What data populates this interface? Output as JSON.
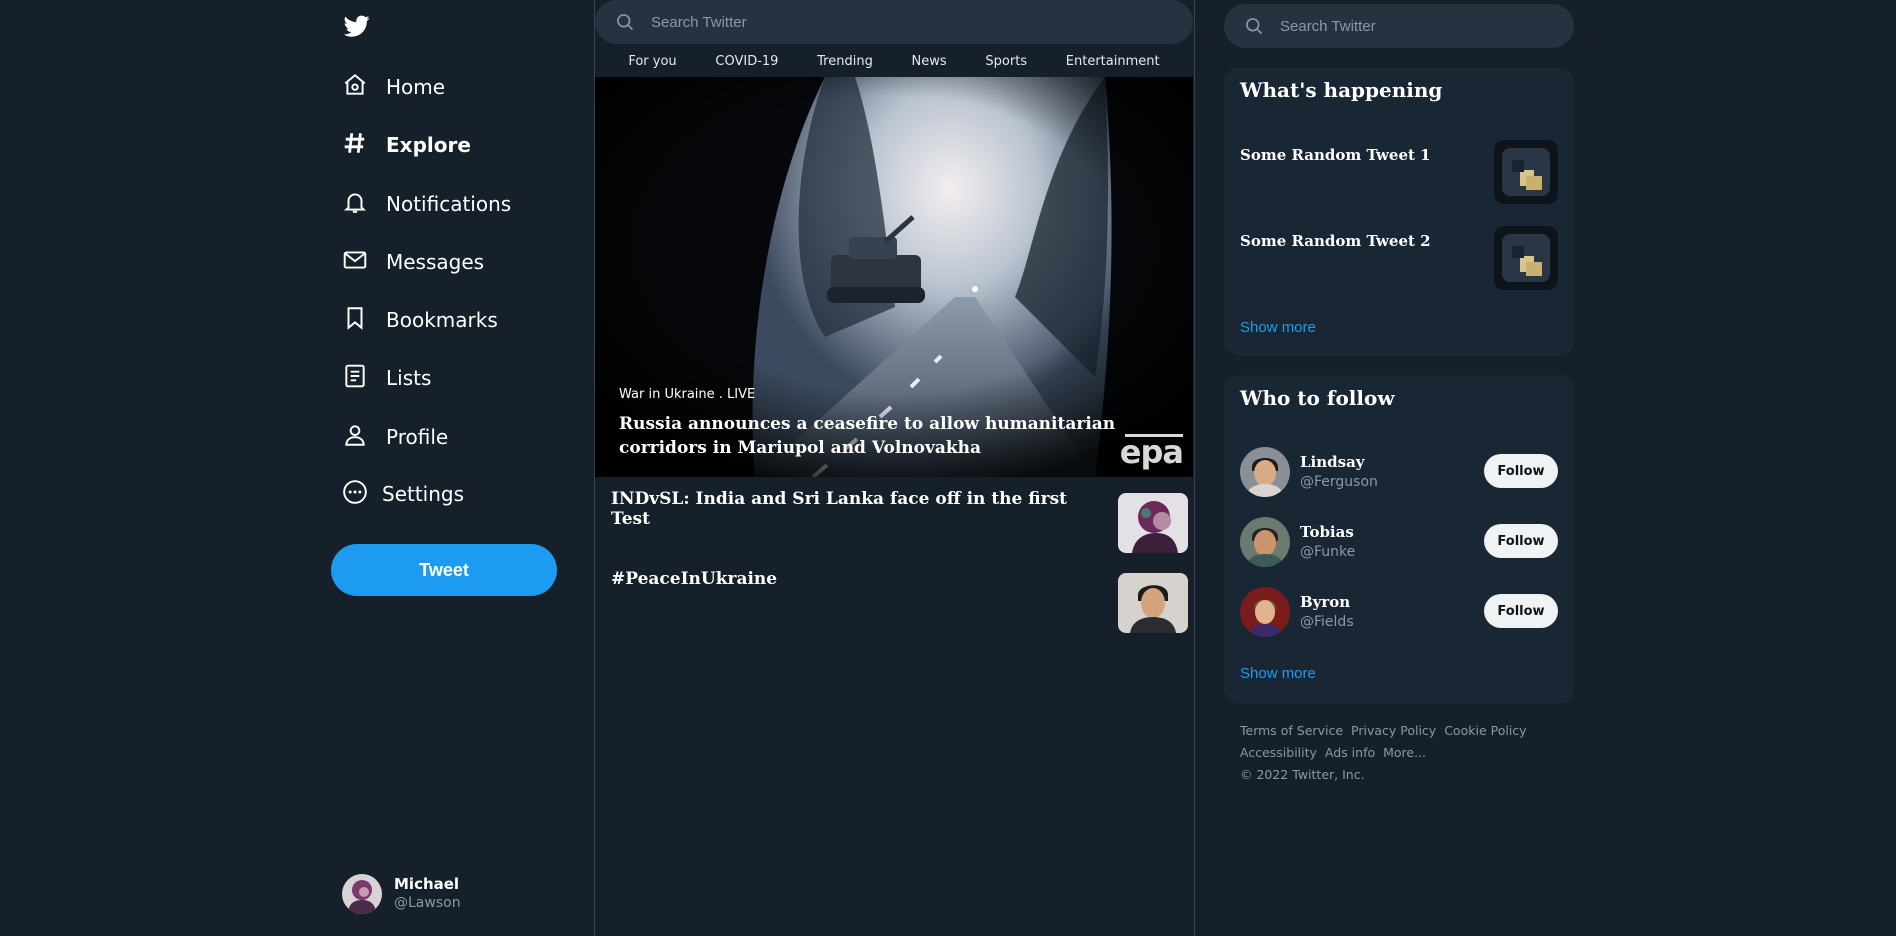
{
  "colors": {
    "background": "#15202b",
    "panel": "#192734",
    "accent": "#1d9bf0",
    "border": "#38444d",
    "muted": "#8b98a5"
  },
  "sidebar": {
    "logo_icon": "twitter-bird-icon",
    "items": [
      {
        "label": "Home",
        "icon": "home-icon"
      },
      {
        "label": "Explore",
        "icon": "hashtag-icon"
      },
      {
        "label": "Notifications",
        "icon": "bell-icon"
      },
      {
        "label": "Messages",
        "icon": "envelope-icon"
      },
      {
        "label": "Bookmarks",
        "icon": "bookmark-icon"
      },
      {
        "label": "Lists",
        "icon": "list-icon"
      },
      {
        "label": "Profile",
        "icon": "person-icon"
      },
      {
        "label": "Settings",
        "icon": "more-circle-icon"
      }
    ],
    "tweet_label": "Tweet",
    "account": {
      "name": "Michael",
      "handle": "@Lawson"
    }
  },
  "center": {
    "search_placeholder": "Search Twitter",
    "tabs": [
      "For you",
      "COVID-19",
      "Trending",
      "News",
      "Sports",
      "Entertainment"
    ],
    "hero": {
      "kicker": "War in Ukraine . LIVE",
      "headline": "Russia announces a ceasefire to allow humanitarian corridors in Mariupol and Volnovakha",
      "watermark": "epa"
    },
    "news": [
      {
        "title": "INDvSL: India and Sri Lanka face off in the first Test"
      },
      {
        "title": "#PeaceInUkraine"
      }
    ]
  },
  "right": {
    "search_placeholder": "Search Twitter",
    "happening": {
      "title": "What's happening",
      "items": [
        {
          "title": "Some Random Tweet 1"
        },
        {
          "title": "Some Random Tweet 2"
        }
      ],
      "show_more": "Show more"
    },
    "who_to_follow": {
      "title": "Who to follow",
      "users": [
        {
          "name": "Lindsay",
          "handle": "@Ferguson",
          "button": "Follow"
        },
        {
          "name": "Tobias",
          "handle": "@Funke",
          "button": "Follow"
        },
        {
          "name": "Byron",
          "handle": "@Fields",
          "button": "Follow"
        }
      ],
      "show_more": "Show more"
    },
    "footer": {
      "links": [
        "Terms of Service",
        "Privacy Policy",
        "Cookie Policy",
        "Accessibility",
        "Ads info",
        "More..."
      ],
      "copyright": "© 2022 Twitter, Inc."
    }
  }
}
